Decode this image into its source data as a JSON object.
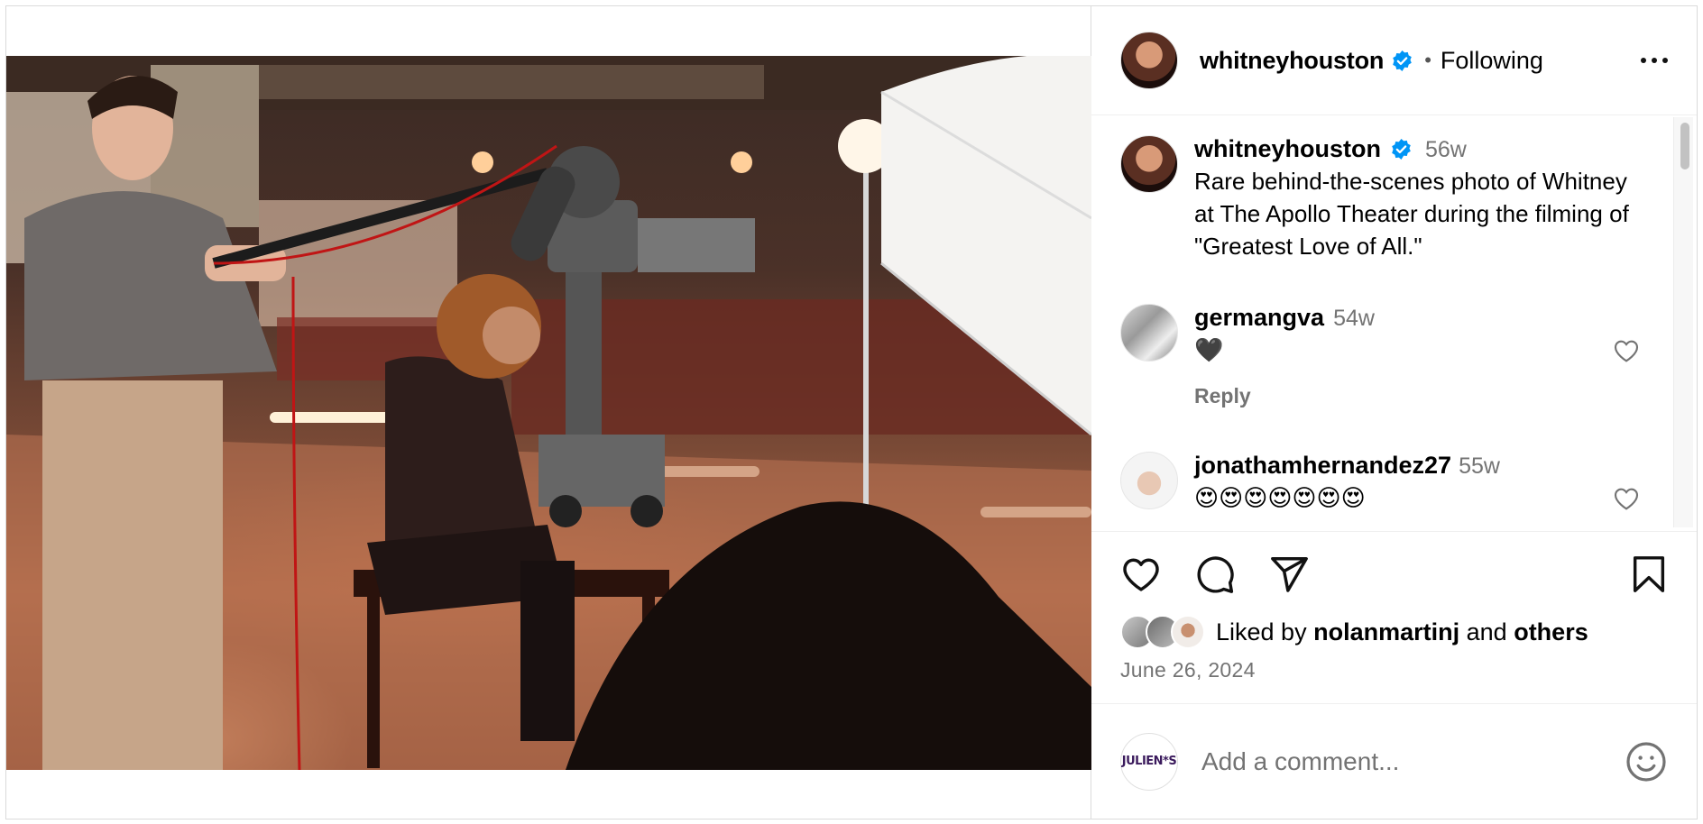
{
  "post": {
    "author": {
      "username": "whitneyhouston",
      "verified": true,
      "follow_status": "Following"
    },
    "caption": {
      "username": "whitneyhouston",
      "age": "56w",
      "text": "Rare behind-the-scenes photo of Whitney at The Apollo Theater during the filming of \"Greatest Love of All.\""
    },
    "comments": [
      {
        "username": "germangva",
        "age": "54w",
        "text": "🖤",
        "reply_label": "Reply"
      },
      {
        "username": "jonathamhernandez27",
        "age": "55w",
        "text": "😍😍😍😍😍😍😍"
      }
    ],
    "likes": {
      "prefix": "Liked by",
      "user": "nolanmartinj",
      "joiner": "and",
      "suffix": "others"
    },
    "date": "June 26, 2024",
    "add_comment": {
      "placeholder": "Add a comment...",
      "viewer_avatar_text": "JULIEN*S"
    },
    "icons": {
      "like": "heart-icon",
      "comment": "comment-icon",
      "share": "paper-plane-icon",
      "save": "bookmark-icon",
      "more": "more-options-icon",
      "emoji": "smiley-icon",
      "verified": "verified-badge-icon"
    },
    "colors": {
      "verified_blue": "#0095f6",
      "secondary_text": "#737373",
      "border": "#dbdbdb"
    }
  }
}
